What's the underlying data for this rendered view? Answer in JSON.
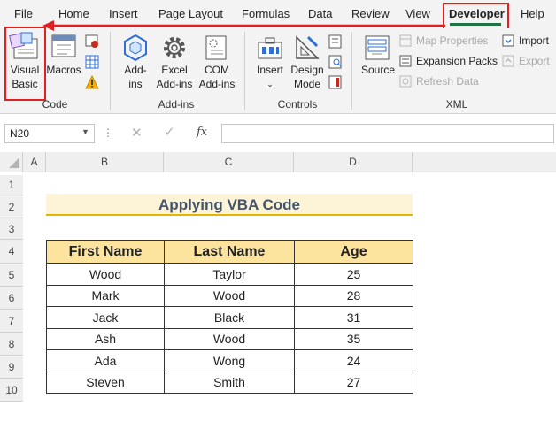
{
  "tabs": [
    "File",
    "Home",
    "Insert",
    "Page Layout",
    "Formulas",
    "Data",
    "Review",
    "View",
    "Developer",
    "Help"
  ],
  "ribbon": {
    "code": {
      "visual_basic_label_1": "Visual",
      "visual_basic_label_2": "Basic",
      "macros_label": "Macros",
      "group_label": "Code"
    },
    "addins": {
      "addins_label_1": "Add-",
      "addins_label_2": "ins",
      "excel_addins_label_1": "Excel",
      "excel_addins_label_2": "Add-ins",
      "com_addins_label_1": "COM",
      "com_addins_label_2": "Add-ins",
      "group_label": "Add-ins"
    },
    "controls": {
      "insert_label": "Insert",
      "design_mode_label_1": "Design",
      "design_mode_label_2": "Mode",
      "group_label": "Controls"
    },
    "xml": {
      "source_label": "Source",
      "map_properties_label": "Map Properties",
      "expansion_packs_label": "Expansion Packs",
      "refresh_data_label": "Refresh Data",
      "import_label": "Import",
      "export_label": "Export",
      "group_label": "XML"
    }
  },
  "formula_bar": {
    "name_box": "N20",
    "fx_label": "fx",
    "value": ""
  },
  "columns": [
    "A",
    "B",
    "C",
    "D"
  ],
  "rows": [
    "1",
    "2",
    "3",
    "4",
    "5",
    "6",
    "7",
    "8",
    "9",
    "10"
  ],
  "sheet": {
    "title": "Applying VBA Code",
    "headers": [
      "First Name",
      "Last Name",
      "Age"
    ],
    "records": [
      [
        "Wood",
        "Taylor",
        "25"
      ],
      [
        "Mark",
        "Wood",
        "28"
      ],
      [
        "Jack",
        "Black",
        "31"
      ],
      [
        "Ash",
        "Wood",
        "35"
      ],
      [
        "Ada",
        "Wong",
        "24"
      ],
      [
        "Steven",
        "Smith",
        "27"
      ]
    ]
  },
  "colors": {
    "accent_green": "#217346",
    "highlight_red": "#e02020",
    "header_fill": "#fde49e",
    "title_fill": "#fdf3d6",
    "title_border": "#e5b400"
  }
}
